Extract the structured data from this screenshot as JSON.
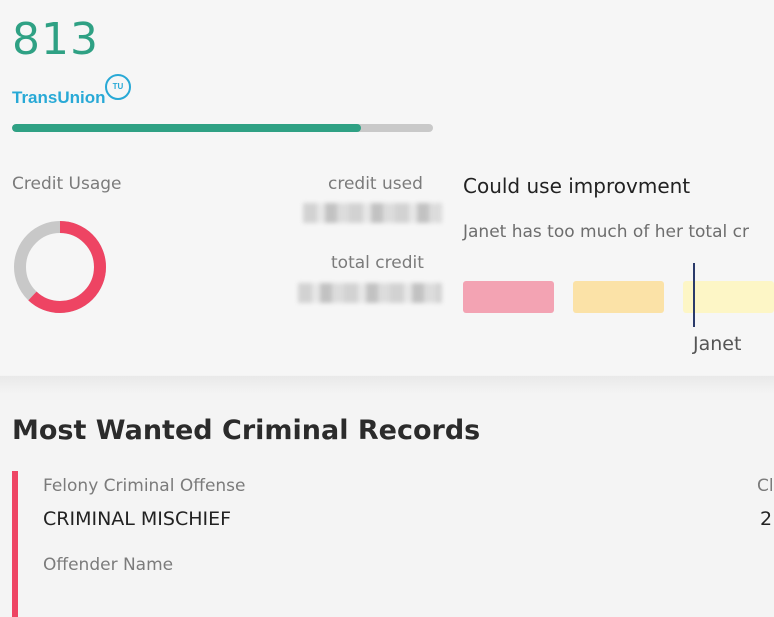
{
  "score": {
    "value": "813",
    "bureau": "TransUnion",
    "bureau_badge": "TU",
    "progress_fraction": 0.83
  },
  "usage": {
    "heading": "Credit Usage",
    "credit_used_label": "credit used",
    "total_credit_label": "total credit",
    "donut_used_fraction": 0.62
  },
  "assessment": {
    "title": "Could use improvment",
    "description": "Janet has too much of her total cr",
    "marker_label": "Janet"
  },
  "records": {
    "title": "Most Wanted Criminal Records",
    "item": {
      "type_label": "Felony Criminal Offense",
      "offense": "CRIMINAL MISCHIEF",
      "offender_label": "Offender Name",
      "col2_label": "Cl",
      "col2_value": "2"
    }
  },
  "colors": {
    "accent_green": "#2fa184",
    "accent_red": "#ee4463",
    "brand_blue": "#28a9d6"
  }
}
